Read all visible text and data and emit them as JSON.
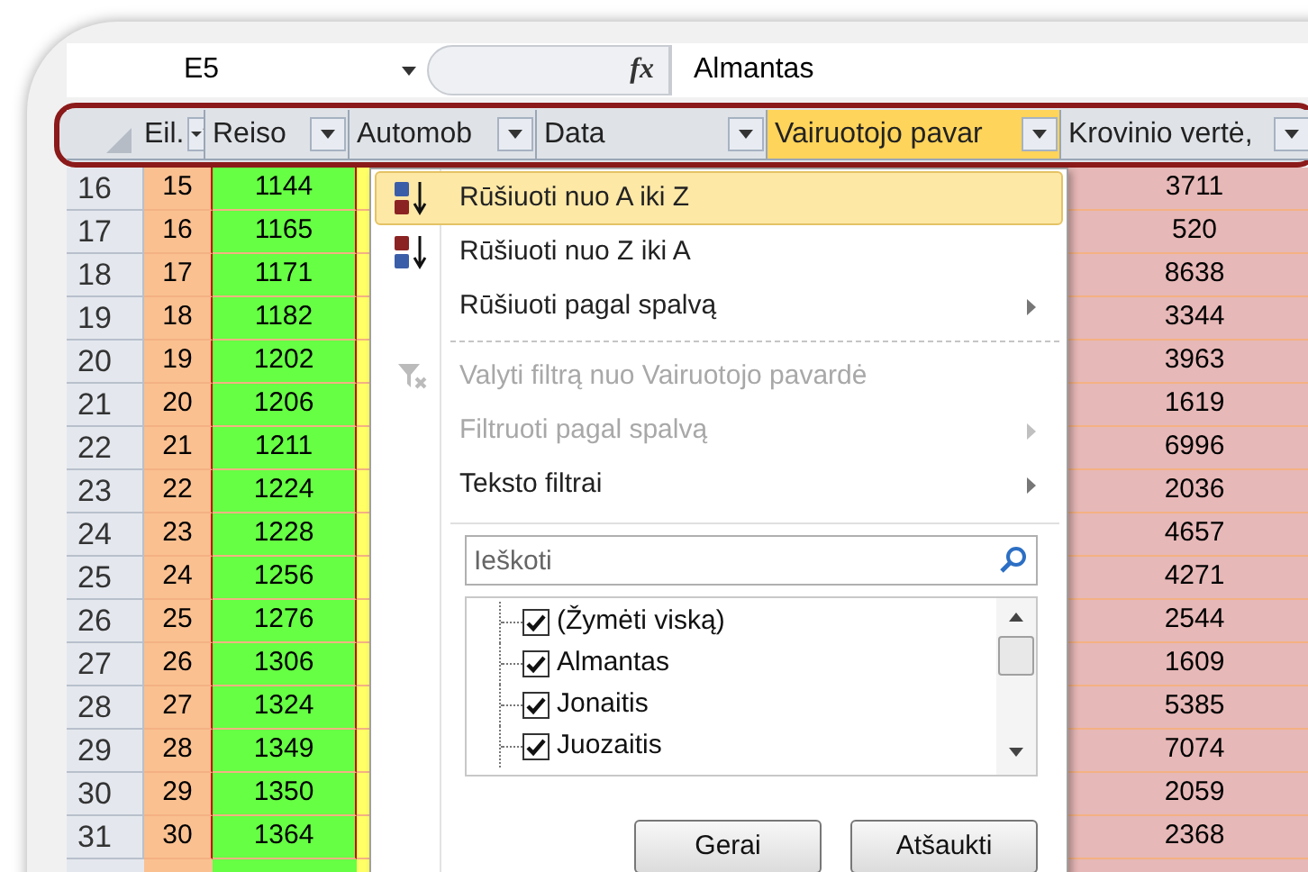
{
  "formula_bar": {
    "name_box": "E5",
    "function_button": "fx",
    "formula": "Almantas"
  },
  "columns": [
    {
      "label": "Eil.",
      "sorted": true,
      "selected": false,
      "color": "#fac090"
    },
    {
      "label": "Reiso",
      "sorted": false,
      "selected": false,
      "color": "#66ff44"
    },
    {
      "label": "Automob",
      "sorted": false,
      "selected": false,
      "color": "#ffff66"
    },
    {
      "label": "Data",
      "sorted": false,
      "selected": false
    },
    {
      "label": "Vairuotojo pavar",
      "sorted": false,
      "selected": true
    },
    {
      "label": "Krovinio vertė,",
      "sorted": false,
      "selected": false,
      "color": "#e6b8b7"
    }
  ],
  "rows": [
    {
      "row": "16",
      "eil": "15",
      "reiso": "1144",
      "krovinio": "3711"
    },
    {
      "row": "17",
      "eil": "16",
      "reiso": "1165",
      "krovinio": "520"
    },
    {
      "row": "18",
      "eil": "17",
      "reiso": "1171",
      "krovinio": "8638"
    },
    {
      "row": "19",
      "eil": "18",
      "reiso": "1182",
      "krovinio": "3344"
    },
    {
      "row": "20",
      "eil": "19",
      "reiso": "1202",
      "krovinio": "3963"
    },
    {
      "row": "21",
      "eil": "20",
      "reiso": "1206",
      "krovinio": "1619"
    },
    {
      "row": "22",
      "eil": "21",
      "reiso": "1211",
      "krovinio": "6996"
    },
    {
      "row": "23",
      "eil": "22",
      "reiso": "1224",
      "krovinio": "2036"
    },
    {
      "row": "24",
      "eil": "23",
      "reiso": "1228",
      "krovinio": "4657"
    },
    {
      "row": "25",
      "eil": "24",
      "reiso": "1256",
      "krovinio": "4271"
    },
    {
      "row": "26",
      "eil": "25",
      "reiso": "1276",
      "krovinio": "2544"
    },
    {
      "row": "27",
      "eil": "26",
      "reiso": "1306",
      "krovinio": "1609"
    },
    {
      "row": "28",
      "eil": "27",
      "reiso": "1324",
      "krovinio": "5385"
    },
    {
      "row": "29",
      "eil": "28",
      "reiso": "1349",
      "krovinio": "7074"
    },
    {
      "row": "30",
      "eil": "29",
      "reiso": "1350",
      "krovinio": "2059"
    },
    {
      "row": "31",
      "eil": "30",
      "reiso": "1364",
      "krovinio": "2368"
    }
  ],
  "filter_menu": {
    "items": [
      {
        "kind": "sort_az",
        "label": "Rūšiuoti nuo A iki Z",
        "selected": true,
        "disabled": false,
        "submenu": false
      },
      {
        "kind": "sort_za",
        "label": "Rūšiuoti nuo Z iki A",
        "selected": false,
        "disabled": false,
        "submenu": false
      },
      {
        "kind": "plain",
        "label": "Rūšiuoti pagal spalvą",
        "selected": false,
        "disabled": false,
        "submenu": true
      },
      {
        "kind": "separator"
      },
      {
        "kind": "clear_filter",
        "label": "Valyti filtrą nuo Vairuotojo pavardė",
        "selected": false,
        "disabled": true,
        "submenu": false
      },
      {
        "kind": "plain",
        "label": "Filtruoti pagal spalvą",
        "selected": false,
        "disabled": true,
        "submenu": true
      },
      {
        "kind": "plain",
        "label": "Teksto filtrai",
        "selected": false,
        "disabled": false,
        "submenu": true
      }
    ],
    "search": {
      "placeholder": "Ieškoti"
    },
    "values": [
      {
        "label": "(Žymėti viską)",
        "checked": true
      },
      {
        "label": "Almantas",
        "checked": true
      },
      {
        "label": "Jonaitis",
        "checked": true
      },
      {
        "label": "Juozaitis",
        "checked": true
      }
    ],
    "buttons": [
      "Gerai",
      "Atšaukti"
    ]
  }
}
